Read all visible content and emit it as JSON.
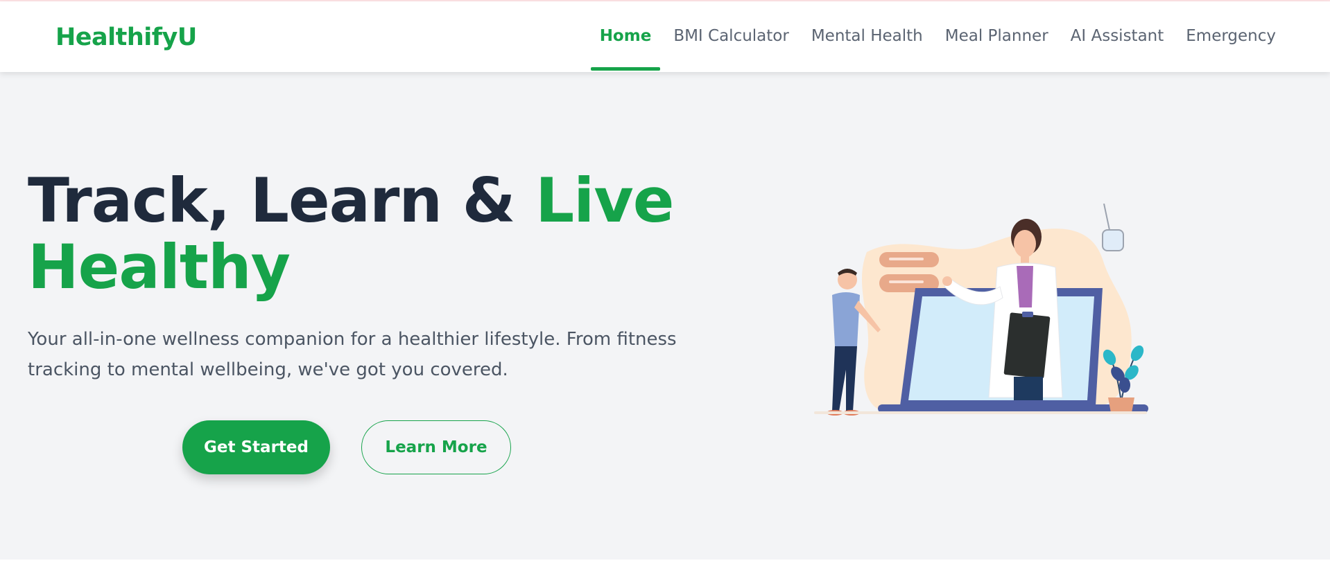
{
  "brand": {
    "name": "HealthifyU",
    "color": "#16a34a"
  },
  "nav": {
    "items": [
      {
        "label": "Home",
        "active": true
      },
      {
        "label": "BMI Calculator",
        "active": false
      },
      {
        "label": "Mental Health",
        "active": false
      },
      {
        "label": "Meal Planner",
        "active": false
      },
      {
        "label": "AI Assistant",
        "active": false
      },
      {
        "label": "Emergency",
        "active": false
      }
    ]
  },
  "hero": {
    "title_part1": "Track, Learn & ",
    "title_accent1": "Live",
    "title_accent2": "Healthy",
    "subtitle": "Your all-in-one wellness companion for a healthier lifestyle. From fitness tracking to mental wellbeing, we've got you covered.",
    "primary_button": "Get Started",
    "secondary_button": "Learn More",
    "illustration_icon": "telemedicine-doctor-laptop-illustration"
  },
  "colors": {
    "accent": "#16a34a",
    "heading": "#1f2a3c",
    "text": "#4b5563",
    "background": "#f3f4f6"
  }
}
